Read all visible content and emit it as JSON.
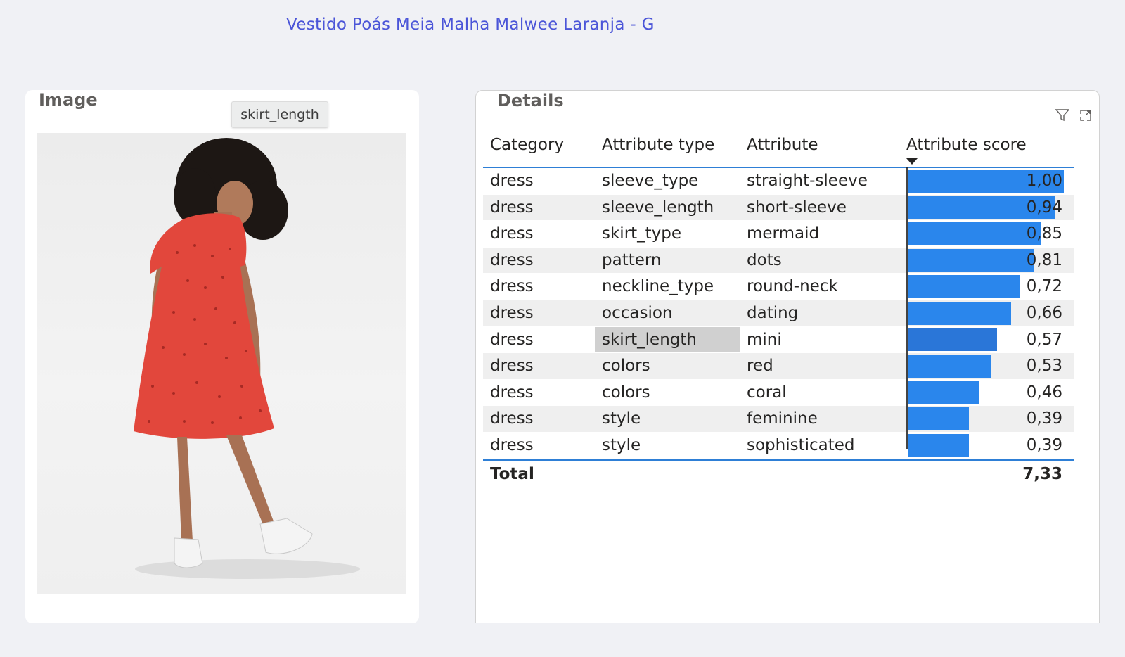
{
  "page": {
    "title": "Vestido Poás Meia Malha Malwee Laranja - G"
  },
  "image_card": {
    "title": "Image",
    "tooltip": "skirt_length"
  },
  "details_card": {
    "title": "Details",
    "icons": [
      "filter-icon",
      "focus-mode-icon"
    ]
  },
  "table": {
    "headers": [
      "Category",
      "Attribute type",
      "Attribute",
      "Attribute score"
    ],
    "sorted_column": "Attribute score",
    "sort_direction": "descending",
    "max_score": 1.0,
    "rows": [
      {
        "category": "dress",
        "type": "sleeve_type",
        "attribute": "straight-sleeve",
        "score": 1.0,
        "label": "1,00"
      },
      {
        "category": "dress",
        "type": "sleeve_length",
        "attribute": "short-sleeve",
        "score": 0.94,
        "label": "0,94"
      },
      {
        "category": "dress",
        "type": "skirt_type",
        "attribute": "mermaid",
        "score": 0.85,
        "label": "0,85"
      },
      {
        "category": "dress",
        "type": "pattern",
        "attribute": "dots",
        "score": 0.81,
        "label": "0,81"
      },
      {
        "category": "dress",
        "type": "neckline_type",
        "attribute": "round-neck",
        "score": 0.72,
        "label": "0,72"
      },
      {
        "category": "dress",
        "type": "occasion",
        "attribute": "dating",
        "score": 0.66,
        "label": "0,66"
      },
      {
        "category": "dress",
        "type": "skirt_length",
        "attribute": "mini",
        "score": 0.57,
        "label": "0,57",
        "hovered": true
      },
      {
        "category": "dress",
        "type": "colors",
        "attribute": "red",
        "score": 0.53,
        "label": "0,53"
      },
      {
        "category": "dress",
        "type": "colors",
        "attribute": "coral",
        "score": 0.46,
        "label": "0,46"
      },
      {
        "category": "dress",
        "type": "style",
        "attribute": "feminine",
        "score": 0.39,
        "label": "0,39"
      },
      {
        "category": "dress",
        "type": "style",
        "attribute": "sophisticated",
        "score": 0.39,
        "label": "0,39"
      }
    ],
    "total_label": "Total",
    "total_value": "7,33"
  },
  "colors": {
    "title": "#4b55d8",
    "bar": "#2a86ec",
    "accent_line": "#2e7fd6",
    "dress": "#e2473c"
  }
}
